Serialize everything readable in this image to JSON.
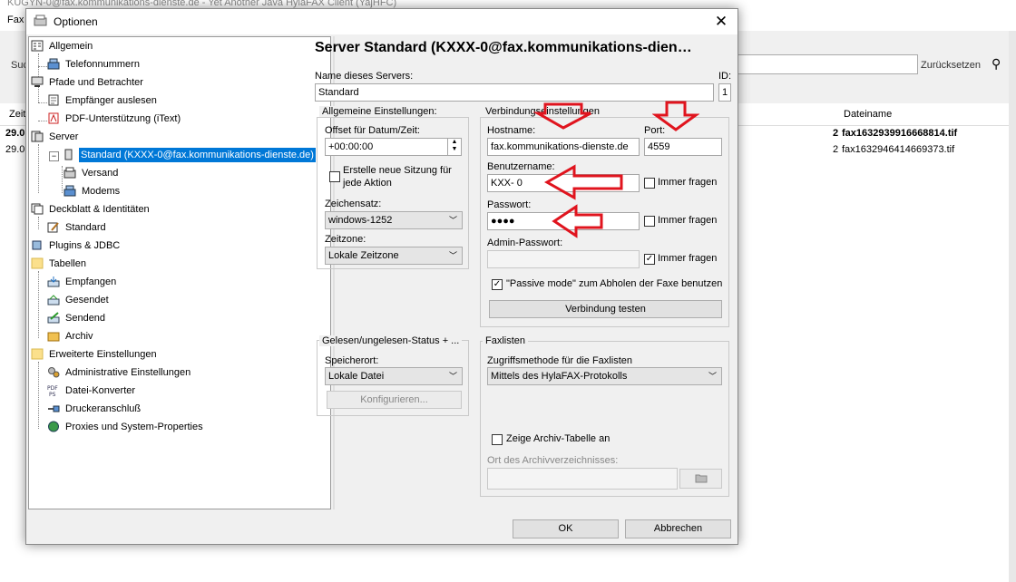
{
  "background": {
    "title": "KUGYN-0@fax.kommunikations-dienste.de - Yet Another Java HylaFAX Client (YajHFC)",
    "menu_first": "Fax",
    "toolbar_label": "Suc",
    "reset_label": "Zurücksetzen",
    "table": {
      "col_first": "Zeit",
      "col_filename": "Dateiname",
      "rows": [
        {
          "time": "29.0",
          "count": "2",
          "file": "fax1632939916668814.tif",
          "bold": true
        },
        {
          "time": "29.0",
          "count": "2",
          "file": "fax1632946414669373.tif",
          "bold": false
        }
      ]
    }
  },
  "dialog": {
    "title": "Optionen",
    "tree": [
      {
        "label": "Allgemein",
        "icon": "settings-icon"
      },
      {
        "label": "Telefonnummern",
        "icon": "phone-icon"
      },
      {
        "label": "Pfade und Betrachter",
        "icon": "computer-icon"
      },
      {
        "label": "Empfänger auslesen",
        "icon": "document-icon"
      },
      {
        "label": "PDF-Unterstützung (iText)",
        "icon": "pdf-icon"
      },
      {
        "label": "Server",
        "icon": "server-icon"
      },
      {
        "label": "Standard (KXXX-0@fax.kommunikations-dienste.de)",
        "icon": "server-icon"
      },
      {
        "label": "Versand",
        "icon": "fax-icon"
      },
      {
        "label": "Modems",
        "icon": "modem-icon"
      },
      {
        "label": "Deckblatt & Identitäten",
        "icon": "pages-icon"
      },
      {
        "label": "Standard",
        "icon": "edit-icon"
      },
      {
        "label": "Plugins & JDBC",
        "icon": "plugin-icon"
      },
      {
        "label": "Tabellen",
        "icon": "folder-icon"
      },
      {
        "label": "Empfangen",
        "icon": "inbox-icon"
      },
      {
        "label": "Gesendet",
        "icon": "outbox-icon"
      },
      {
        "label": "Sendend",
        "icon": "sending-icon"
      },
      {
        "label": "Archiv",
        "icon": "archive-icon"
      },
      {
        "label": "Erweiterte Einstellungen",
        "icon": "folder-icon"
      },
      {
        "label": "Administrative Einstellungen",
        "icon": "gears-icon"
      },
      {
        "label": "Datei-Konverter",
        "icon": "converter-icon"
      },
      {
        "label": "Druckeranschluß",
        "icon": "plug-icon"
      },
      {
        "label": "Proxies und System-Properties",
        "icon": "globe-icon"
      }
    ],
    "panel_title": "Server Standard (KXXX-0@fax.kommunikations-dien…",
    "server_name_label": "Name dieses Servers:",
    "server_name_value": "Standard",
    "id_label": "ID:",
    "id_value": "1",
    "general": {
      "legend": "Allgemeine Einstellungen:",
      "offset_label": "Offset für Datum/Zeit:",
      "offset_value": "+00:00:00",
      "new_session_label": "Erstelle neue Sitzung für jede Aktion",
      "charset_label": "Zeichensatz:",
      "charset_value": "windows-1252",
      "timezone_label": "Zeitzone:",
      "timezone_value": "Lokale Zeitzone"
    },
    "connection": {
      "legend": "Verbindungseinstellungen",
      "host_label": "Hostname:",
      "host_value": "fax.kommunikations-dienste.de",
      "port_label": "Port:",
      "port_value": "4559",
      "user_label": "Benutzername:",
      "user_value": "KXX- 0",
      "ask_label": "Immer fragen",
      "password_label": "Passwort:",
      "password_value": "●●●●",
      "admin_label": "Admin-Passwort:",
      "passive_label": "\"Passive mode\" zum Abholen der Faxe benutzen",
      "test_button": "Verbindung testen"
    },
    "read_status": {
      "legend": "Gelesen/ungelesen-Status + ...",
      "location_label": "Speicherort:",
      "location_value": "Lokale Datei",
      "configure_button": "Konfigurieren..."
    },
    "faxlists": {
      "legend": "Faxlisten",
      "method_label": "Zugriffsmethode für die Faxlisten",
      "method_value": "Mittels des HylaFAX-Protokolls",
      "archive_label": "Zeige Archiv-Tabelle an",
      "archive_dir_label": "Ort des Archivverzeichnisses:"
    },
    "ok_button": "OK",
    "cancel_button": "Abbrechen"
  },
  "colors": {
    "selection": "#0078d7",
    "annotation_arrow": "#e0141e"
  }
}
